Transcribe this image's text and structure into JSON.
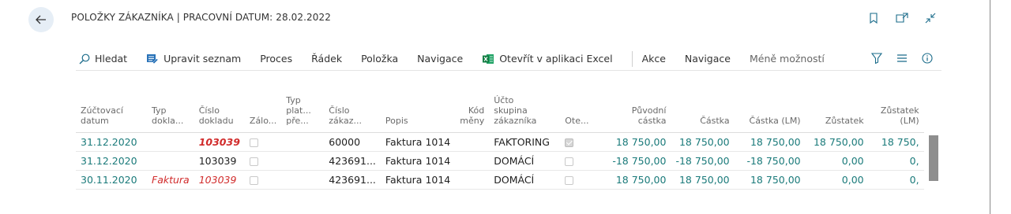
{
  "header": {
    "title": "POLOŽKY ZÁKAZNÍKA | PRACOVNÍ DATUM: 28.02.2022"
  },
  "actions": [
    {
      "label": "Hledat",
      "icon": "search-icon"
    },
    {
      "label": "Upravit seznam",
      "icon": "edit-list-icon"
    },
    {
      "label": "Proces"
    },
    {
      "label": "Řádek"
    },
    {
      "label": "Položka"
    },
    {
      "label": "Navigace"
    },
    {
      "label": "Otevřít v aplikaci Excel",
      "icon": "excel-icon"
    },
    {
      "label": "Akce"
    },
    {
      "label": "Navigace"
    },
    {
      "label": "Méně možností"
    }
  ],
  "columns": [
    "Zúčtovací\ndatum",
    "Typ\ndokla...",
    "Číslo\ndokladu",
    "Zálo...",
    "Typ\nplat...\npře...",
    "Číslo\nzákaz...",
    "Popis",
    "Kód\nměny",
    "Účto\nskupina\nzákazníka",
    "Ote...",
    "Původní\ncástka",
    "Částka",
    "Částka (LM)",
    "Zůstatek",
    "Zůstatek\n(LM)"
  ],
  "rows": [
    {
      "date": "31.12.2020",
      "doc_type": "",
      "doc_no": "103039",
      "customer_no": "60000",
      "description": "Faktura 1014",
      "group": "FAKTORING",
      "open": true,
      "original": "18 750,00",
      "amount": "18 750,00",
      "amount_lm": "18 750,00",
      "remaining": "18 750,00",
      "remaining_lm": "18 750,"
    },
    {
      "date": "31.12.2020",
      "doc_type": "",
      "doc_no": "103039",
      "customer_no": "423691...",
      "description": "Faktura 1014",
      "group": "DOMÁCÍ",
      "open": false,
      "original": "-18 750,00",
      "amount": "-18 750,00",
      "amount_lm": "-18 750,00",
      "remaining": "0,00",
      "remaining_lm": "0,"
    },
    {
      "date": "30.11.2020",
      "doc_type": "Faktura",
      "doc_no": "103039",
      "customer_no": "423691...",
      "description": "Faktura 1014",
      "group": "DOMÁCÍ",
      "open": false,
      "original": "18 750,00",
      "amount": "18 750,00",
      "amount_lm": "18 750,00",
      "remaining": "0,00",
      "remaining_lm": "0,"
    }
  ],
  "colors": {
    "link": "#1a7a7a",
    "accent_red": "#d12b2b",
    "back_bg": "#e6eef6"
  }
}
